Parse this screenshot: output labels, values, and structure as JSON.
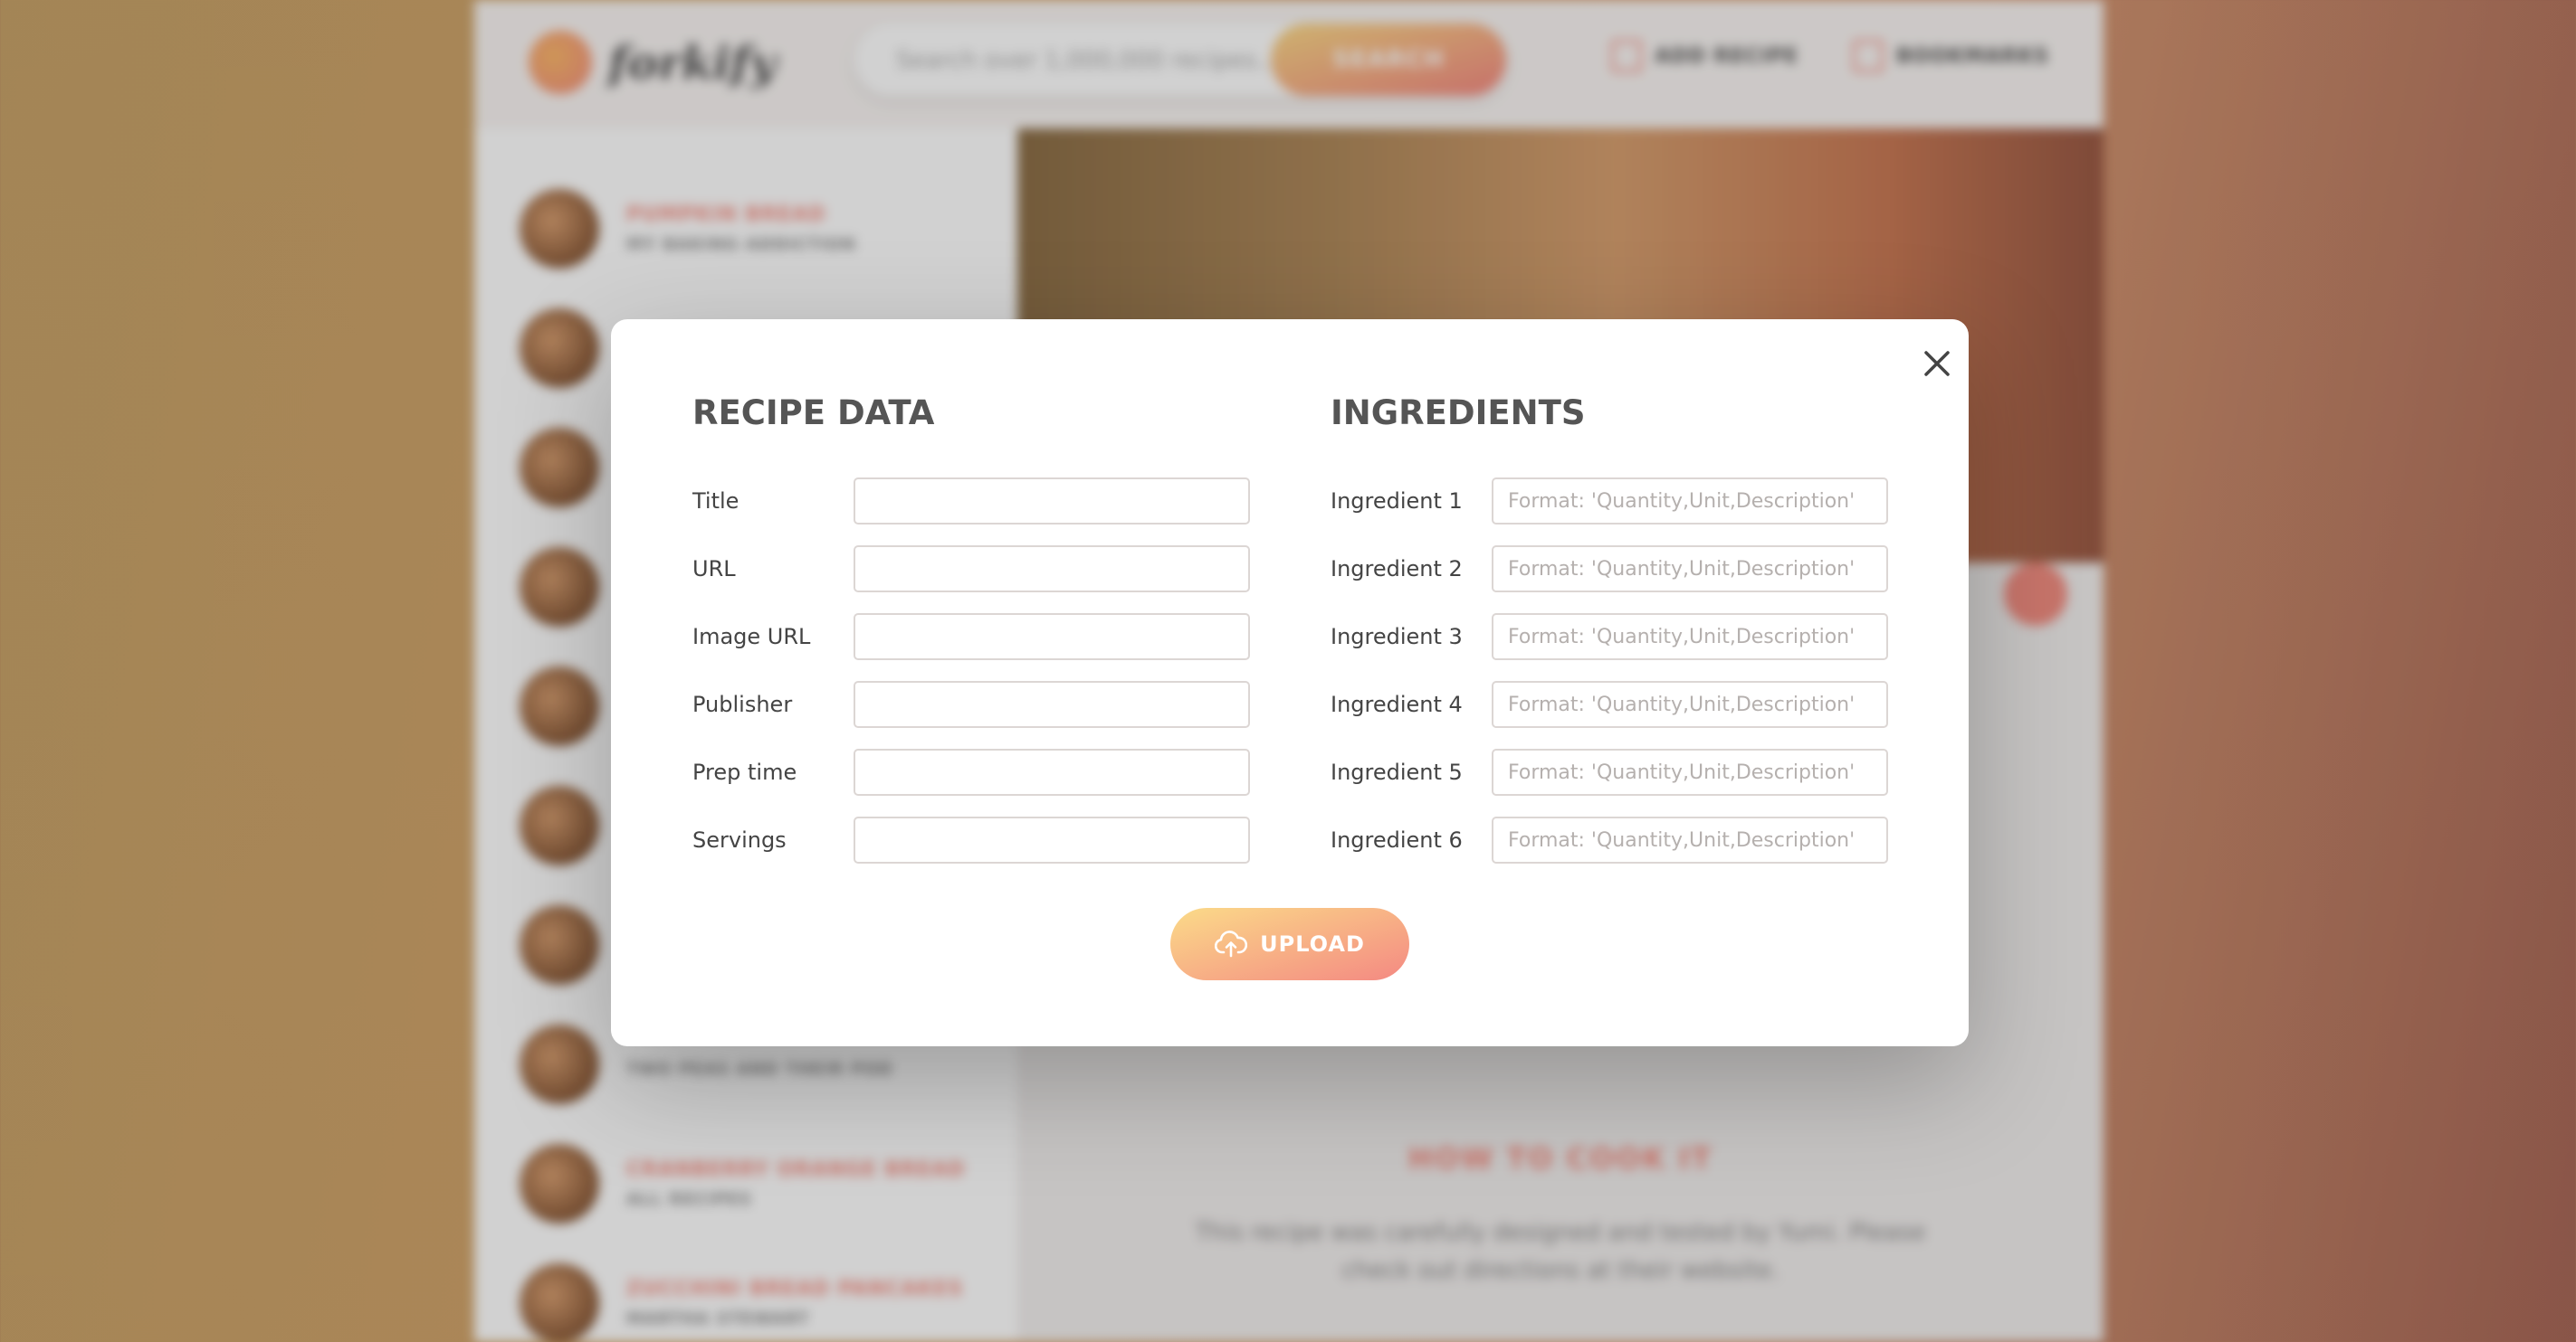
{
  "background_app": {
    "logo_text": "forkify",
    "search_placeholder": "Search over 1,000,000 recipes...",
    "search_button": "SEARCH",
    "nav": {
      "add_recipe": "ADD RECIPE",
      "bookmarks": "BOOKMARKS"
    },
    "results": [
      {
        "title": "PUMPKIN BREAD",
        "publisher": "MY BAKING ADDICTION"
      },
      {
        "title": "",
        "publisher": ""
      },
      {
        "title": "",
        "publisher": ""
      },
      {
        "title": "",
        "publisher": ""
      },
      {
        "title": "",
        "publisher": ""
      },
      {
        "title": "",
        "publisher": ""
      },
      {
        "title": "",
        "publisher": ""
      },
      {
        "title": "",
        "publisher": "TWO PEAS AND THEIR POD"
      },
      {
        "title": "CRANBERRY ORANGE BREAD",
        "publisher": "ALL RECIPES"
      },
      {
        "title": "ZUCCHINI BREAD PANCAKES",
        "publisher": "MARTHA STEWART"
      }
    ],
    "how_to_cook": {
      "heading": "HOW TO COOK IT",
      "text": "This recipe was carefully designed and tested by Yumi. Please check out directions at their website."
    }
  },
  "modal": {
    "recipe_heading": "RECIPE DATA",
    "ingredients_heading": "INGREDIENTS",
    "recipe_fields": [
      {
        "label": "Title",
        "value": "",
        "placeholder": ""
      },
      {
        "label": "URL",
        "value": "",
        "placeholder": ""
      },
      {
        "label": "Image URL",
        "value": "",
        "placeholder": ""
      },
      {
        "label": "Publisher",
        "value": "",
        "placeholder": ""
      },
      {
        "label": "Prep time",
        "value": "",
        "placeholder": ""
      },
      {
        "label": "Servings",
        "value": "",
        "placeholder": ""
      }
    ],
    "ingredient_fields": [
      {
        "label": "Ingredient 1",
        "value": "",
        "placeholder": "Format: 'Quantity,Unit,Description'"
      },
      {
        "label": "Ingredient 2",
        "value": "",
        "placeholder": "Format: 'Quantity,Unit,Description'"
      },
      {
        "label": "Ingredient 3",
        "value": "",
        "placeholder": "Format: 'Quantity,Unit,Description'"
      },
      {
        "label": "Ingredient 4",
        "value": "",
        "placeholder": "Format: 'Quantity,Unit,Description'"
      },
      {
        "label": "Ingredient 5",
        "value": "",
        "placeholder": "Format: 'Quantity,Unit,Description'"
      },
      {
        "label": "Ingredient 6",
        "value": "",
        "placeholder": "Format: 'Quantity,Unit,Description'"
      }
    ],
    "upload_button": "UPLOAD",
    "close_icon": "close-icon",
    "upload_icon": "cloud-upload-icon"
  },
  "colors": {
    "accent_start": "#fbdb89",
    "accent_end": "#f48982",
    "heading_text": "#555555"
  }
}
